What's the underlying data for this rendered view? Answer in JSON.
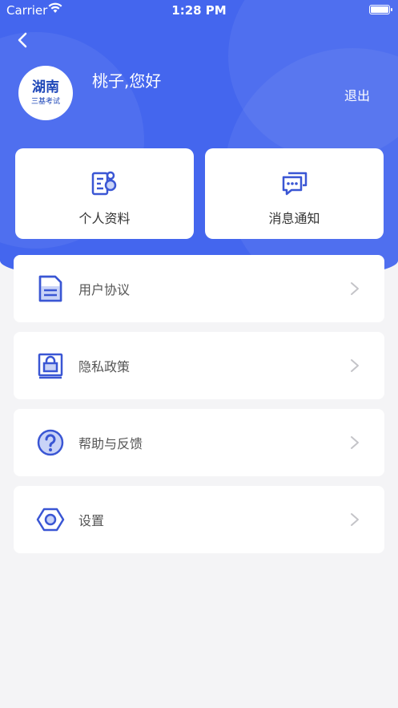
{
  "status_bar": {
    "carrier": "Carrier",
    "time": "1:28 PM"
  },
  "header": {
    "avatar_title": "湖南",
    "avatar_subtitle": "三基考试",
    "greeting": "桃子,您好",
    "logout_label": "退出"
  },
  "cards": [
    {
      "label": "个人资料",
      "icon": "profile-icon"
    },
    {
      "label": "消息通知",
      "icon": "message-icon"
    }
  ],
  "menu": [
    {
      "label": "用户协议",
      "icon": "document-icon"
    },
    {
      "label": "隐私政策",
      "icon": "lock-icon"
    },
    {
      "label": "帮助与反馈",
      "icon": "help-icon"
    },
    {
      "label": "设置",
      "icon": "settings-icon"
    }
  ],
  "colors": {
    "primary": "#4466ee",
    "icon": "#3a56d4",
    "background": "#f4f4f6"
  }
}
